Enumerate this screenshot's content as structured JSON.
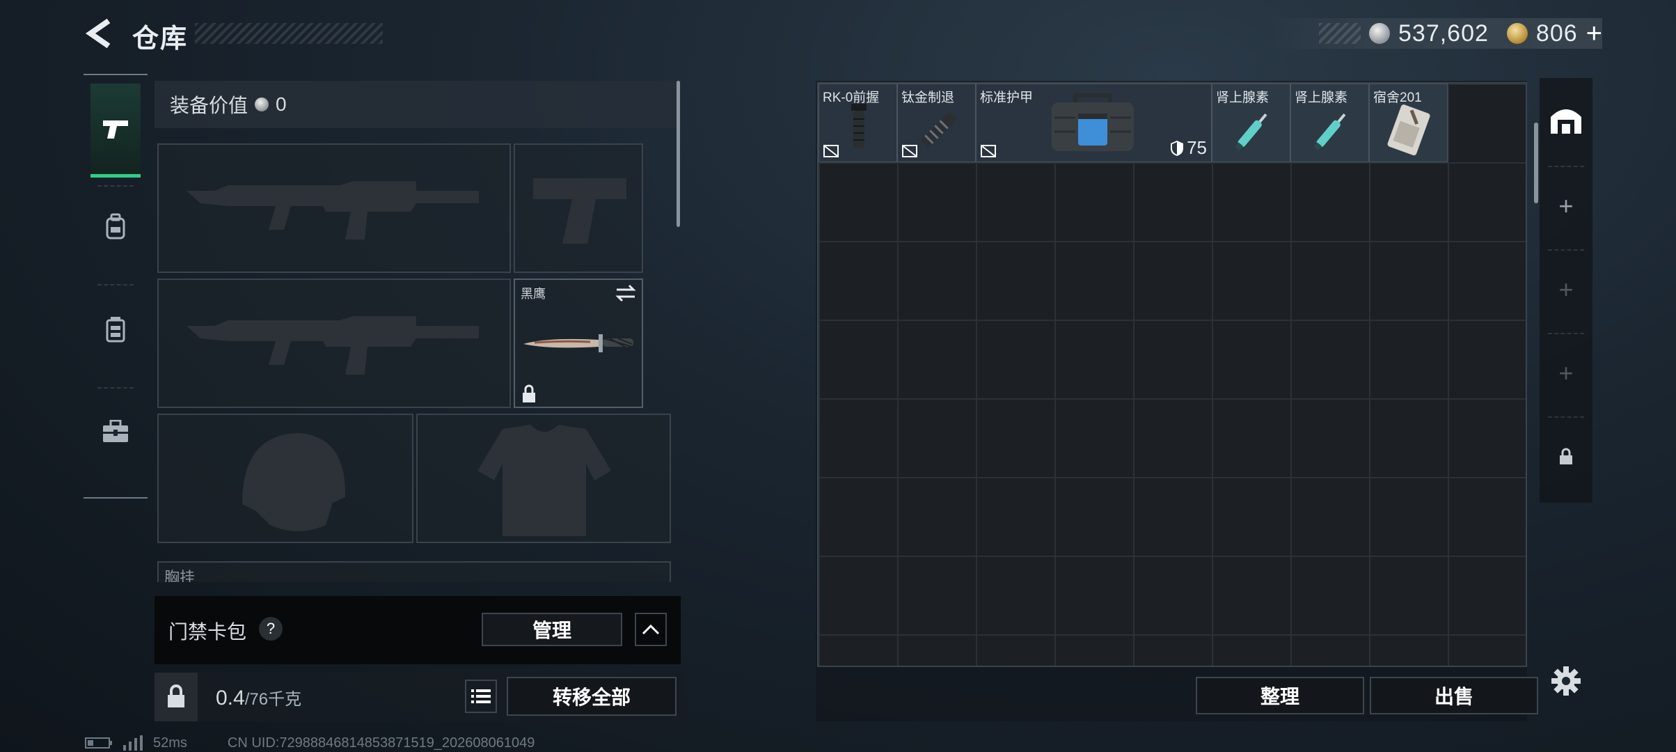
{
  "header": {
    "title": "仓库",
    "silver_amount": "537,602",
    "gold_amount": "806",
    "plus_label": "+"
  },
  "equipment": {
    "value_label": "装备价值",
    "value": "0",
    "melee_name": "黑鹰",
    "chest_label_partial": "胸挂"
  },
  "card_pack": {
    "label": "门禁卡包",
    "help": "?",
    "manage_label": "管理"
  },
  "bottom_left": {
    "weight_current": "0.4",
    "weight_max": "/76千克",
    "transfer_label": "转移全部"
  },
  "storage": {
    "items": [
      {
        "name": "RK-0前握",
        "no_entry": true
      },
      {
        "name": "钛金制退",
        "no_entry": true
      },
      {
        "name": "标准护甲",
        "no_entry": true,
        "durability": "75"
      },
      {
        "name": "肾上腺素",
        "no_entry": false
      },
      {
        "name": "肾上腺素",
        "no_entry": false
      },
      {
        "name": "宿舍201",
        "no_entry": false
      }
    ],
    "sort_label": "整理",
    "sell_label": "出售"
  },
  "sidebar": {
    "add_labels": [
      "+",
      "+",
      "+"
    ]
  },
  "status": {
    "ping": "52ms",
    "uid": "CN UID:7298884681485387151​9_202608061049"
  },
  "colors": {
    "accent_green": "#2ecf8a",
    "background": "#1b2631"
  }
}
